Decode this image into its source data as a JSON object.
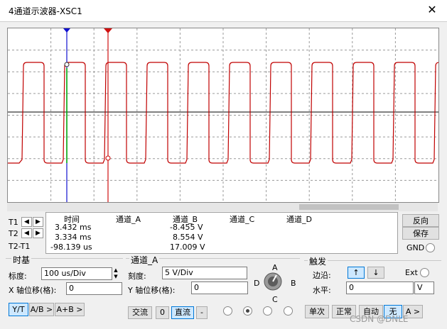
{
  "window": {
    "title": "4通道示波器-XSC1"
  },
  "cursors": {
    "t1": "T1",
    "t2": "T2",
    "t2t1": "T2-T1"
  },
  "readout": {
    "headers": [
      "时间",
      "通道_A",
      "通道_B",
      "通道_C",
      "通道_D"
    ],
    "rows": [
      {
        "time": "3.432 ms",
        "b": "-8.455 V"
      },
      {
        "time": "3.334 ms",
        "b": "8.554 V"
      },
      {
        "time": "-98.139 us",
        "b": "17.009 V"
      }
    ]
  },
  "right_panel": {
    "reverse": "反向",
    "save": "保存",
    "gnd": "GND"
  },
  "timebase": {
    "title": "时基",
    "scale_label": "标度:",
    "scale_value": "100 us/Div",
    "xpos_label": "X 轴位移(格):",
    "xpos_value": "0",
    "modes": [
      "Y/T",
      "A/B >",
      "A+B >"
    ]
  },
  "channel": {
    "title": "通道_A",
    "scale_label": "刻度:",
    "scale_value": "5  V/Div",
    "ypos_label": "Y 轴位移(格):",
    "ypos_value": "0",
    "coupling": [
      "交流",
      "0",
      "直流",
      "-"
    ],
    "knob_labels": {
      "a": "A",
      "b": "B",
      "c": "C",
      "d": "D"
    }
  },
  "trigger": {
    "title": "触发",
    "edge_label": "边沿:",
    "ext": "Ext",
    "level_label": "水平:",
    "level_value": "0",
    "level_unit": "V",
    "modes": [
      "单次",
      "正常",
      "自动",
      "无",
      "A >"
    ]
  },
  "watermark": "CSDN @DNLE"
}
